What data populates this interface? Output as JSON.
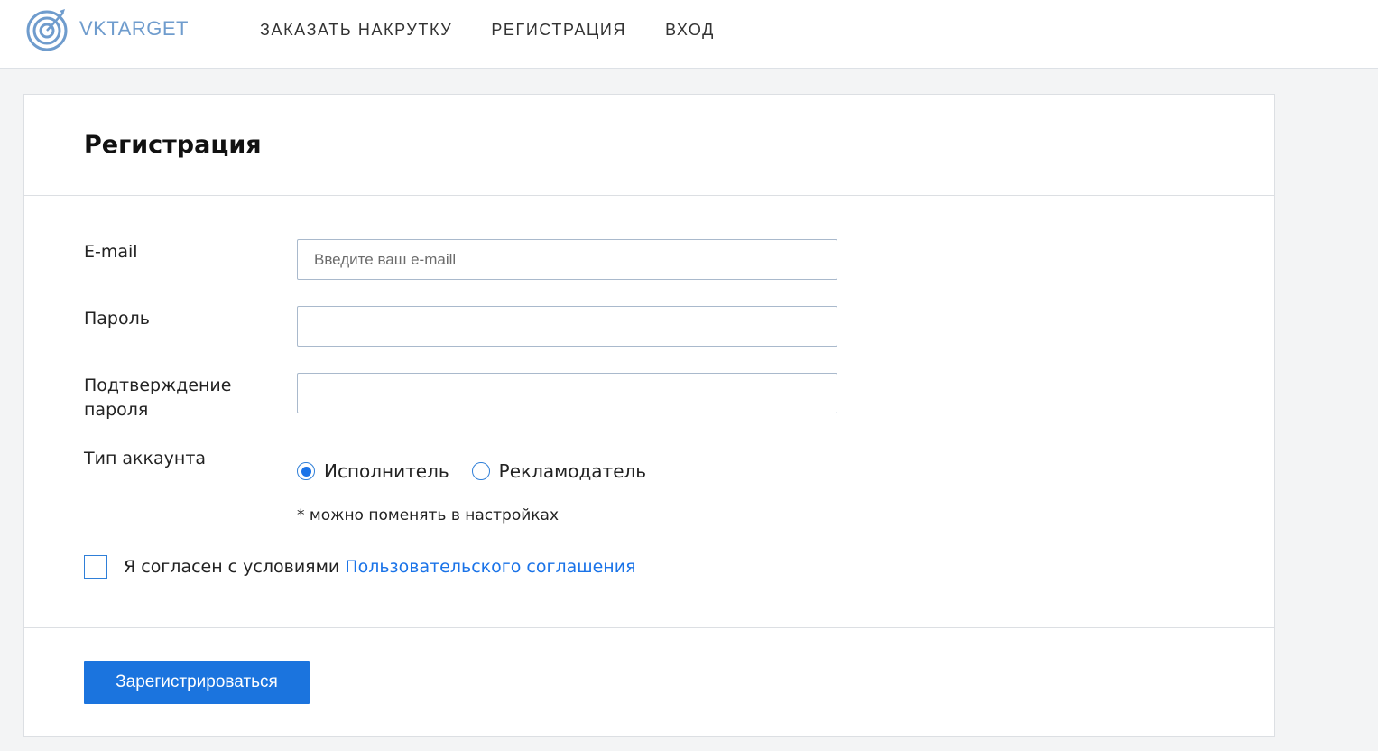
{
  "brand": {
    "logo_text": "VKTARGET",
    "logo_icon": "target-icon",
    "color": "#6f9ccd"
  },
  "nav": {
    "items": [
      {
        "label": "ЗАКАЗАТЬ НАКРУТКУ"
      },
      {
        "label": "РЕГИСТРАЦИЯ"
      },
      {
        "label": "ВХОД"
      }
    ]
  },
  "form": {
    "title": "Регистрация",
    "email": {
      "label": "E-mail",
      "placeholder": "Введите ваш e-maill",
      "value": ""
    },
    "password": {
      "label": "Пароль",
      "value": ""
    },
    "confirm": {
      "label": "Подтверждение пароля",
      "value": ""
    },
    "account_type": {
      "label": "Тип аккаунта",
      "options": [
        {
          "label": "Исполнитель",
          "selected": true
        },
        {
          "label": "Рекламодатель",
          "selected": false
        }
      ],
      "note": "* можно поменять в настройках"
    },
    "agree": {
      "text": "Я согласен с условиями",
      "link": "Пользовательского соглашения",
      "checked": false
    },
    "submit_label": "Зарегистрироваться"
  },
  "colors": {
    "accent": "#1b74de",
    "link": "#1a73e8",
    "background": "#f3f4f5"
  }
}
